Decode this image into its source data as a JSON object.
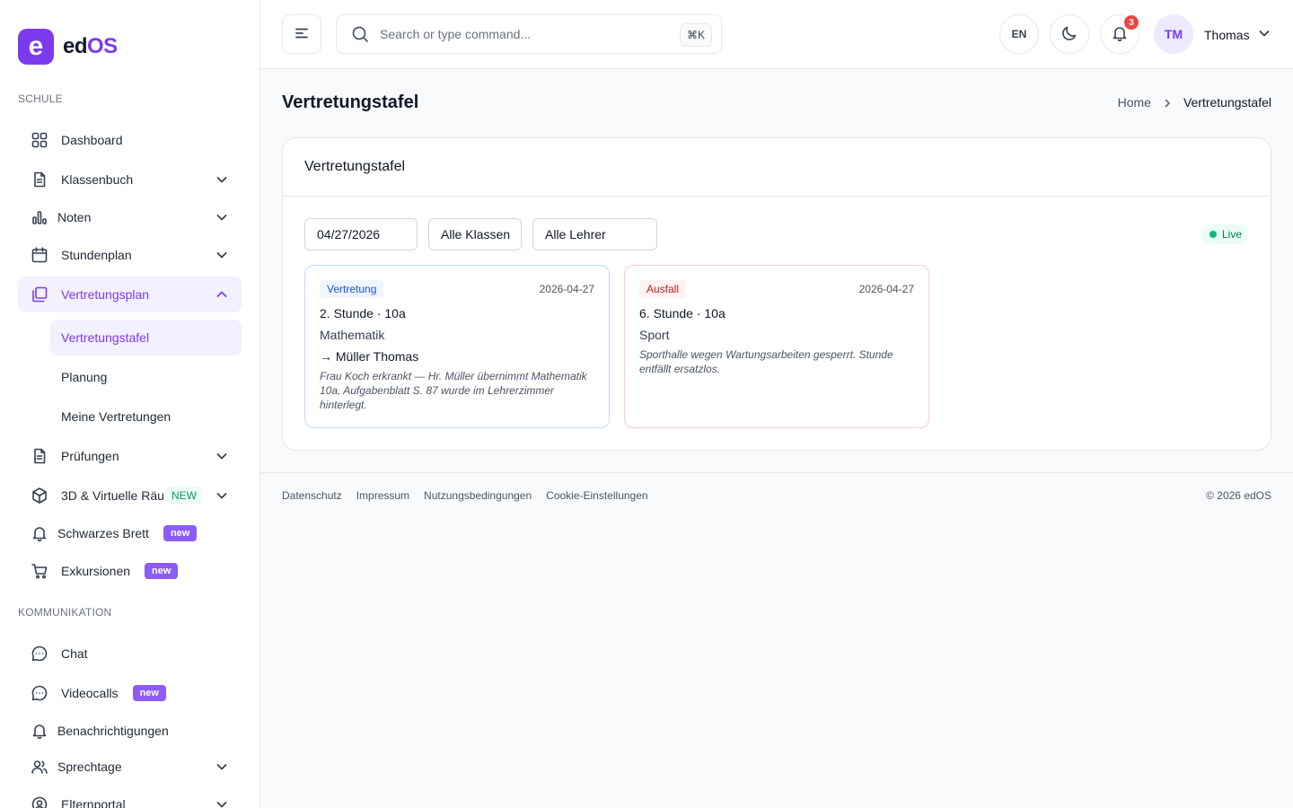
{
  "brand": {
    "logo_letter": "e",
    "name_part1": "ed",
    "name_part2": "OS",
    "accent": "#7c3aed"
  },
  "sidebar": {
    "section_school": "SCHULE",
    "section_comm": "KOMMUNIKATION",
    "items": [
      {
        "label": "Dashboard",
        "icon": "grid-icon"
      },
      {
        "label": "Klassenbuch",
        "icon": "document-icon"
      },
      {
        "label": "Noten",
        "icon": "bar-chart-icon"
      },
      {
        "label": "Stundenplan",
        "icon": "calendar-icon"
      },
      {
        "label": "Vertretungsplan",
        "icon": "copy-icon"
      },
      {
        "label": "Prüfungen",
        "icon": "document-icon"
      },
      {
        "label": "3D & Virtuelle Räume",
        "icon": "cube-icon",
        "badge": "NEW"
      },
      {
        "label": "Schwarzes Brett",
        "icon": "bell-icon",
        "badge": "new"
      },
      {
        "label": "Exkursionen",
        "icon": "cart-icon",
        "badge": "new"
      }
    ],
    "sub_items": [
      "Vertretungstafel",
      "Planung",
      "Meine Vertretungen"
    ],
    "comm_items": [
      {
        "label": "Chat",
        "icon": "chat-icon"
      },
      {
        "label": "Videocalls",
        "icon": "chat-icon",
        "badge": "new"
      },
      {
        "label": "Benachrichtigungen",
        "icon": "bell-icon"
      },
      {
        "label": "Sprechtage",
        "icon": "users-icon"
      },
      {
        "label": "Elternportal",
        "icon": "user-circle-icon"
      }
    ]
  },
  "header": {
    "search_placeholder": "Search or type command...",
    "shortcut": "⌘K",
    "language": "EN",
    "notification_count": "3",
    "avatar_initials": "TM",
    "user_name": "Thomas"
  },
  "page": {
    "title": "Vertretungstafel",
    "breadcrumb_home": "Home",
    "breadcrumb_current": "Vertretungstafel"
  },
  "panel": {
    "title": "Vertretungstafel",
    "date_filter": "04/27/2026",
    "class_filter": "Alle Klassen",
    "teacher_filter": "Alle Lehrer",
    "live_label": "Live",
    "cards": [
      {
        "tag": "Vertretung",
        "date": "2026-04-27",
        "period": "2. Stunde · 10a",
        "subject": "Mathematik",
        "substitute": "→ Müller Thomas",
        "note": "Frau Koch erkrankt — Hr. Müller übernimmt Mathematik 10a, Aufgabenblatt S. 87 wurde im Lehrerzimmer hinterlegt."
      },
      {
        "tag": "Ausfall",
        "date": "2026-04-27",
        "period": "6. Stunde · 10a",
        "subject": "Sport",
        "note": "Sporthalle wegen Wartungsarbeiten gesperrt. Stunde entfällt ersatzlos."
      }
    ]
  },
  "footer": {
    "links": [
      "Datenschutz",
      "Impressum",
      "Nutzungsbedingungen",
      "Cookie-Einstellungen"
    ],
    "copyright": "© 2026 edOS"
  }
}
